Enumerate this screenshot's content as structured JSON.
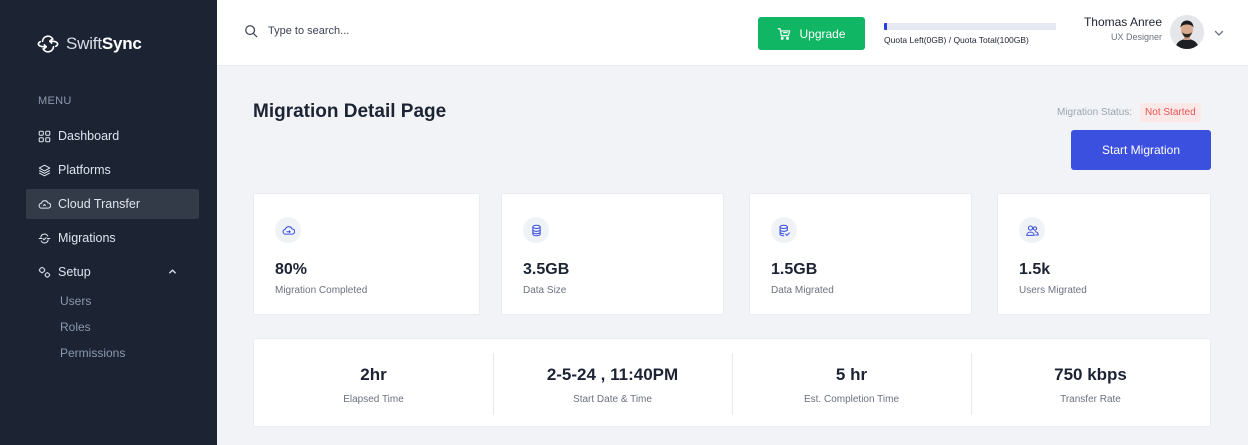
{
  "brand": {
    "name_light": "Swift",
    "name_bold": "Sync"
  },
  "sidebar": {
    "menu_label": "MENU",
    "items": [
      {
        "label": "Dashboard",
        "icon": "grid-icon"
      },
      {
        "label": "Platforms",
        "icon": "layers-icon"
      },
      {
        "label": "Cloud Transfer",
        "icon": "cloud-icon",
        "active": true
      },
      {
        "label": "Migrations",
        "icon": "migration-icon"
      },
      {
        "label": "Setup",
        "icon": "setup-icon",
        "expanded": true
      }
    ],
    "setup_subitems": [
      "Users",
      "Roles",
      "Permissions"
    ]
  },
  "header": {
    "search_placeholder": "Type to search...",
    "upgrade_label": "Upgrade",
    "quota_text": "Quota Left(0GB) / Quota Total(100GB)",
    "quota_fill_fraction": 0.02,
    "user_name": "Thomas Anree",
    "user_role": "UX Designer"
  },
  "main": {
    "title": "Migration Detail Page",
    "status_label": "Migration Status:",
    "status_value": "Not Started",
    "start_button": "Start Migration",
    "cards": [
      {
        "value": "80%",
        "label": "Migration Completed",
        "icon": "cloud-sync-icon"
      },
      {
        "value": "3.5GB",
        "label": "Data Size",
        "icon": "database-icon"
      },
      {
        "value": "1.5GB",
        "label": "Data Migrated",
        "icon": "database-check-icon"
      },
      {
        "value": "1.5k",
        "label": "Users Migrated",
        "icon": "users-icon"
      }
    ],
    "stats": [
      {
        "value": "2hr",
        "label": "Elapsed Time"
      },
      {
        "value": "2-5-24 , 11:40PM",
        "label": "Start Date & Time"
      },
      {
        "value": "5 hr",
        "label": "Est. Completion Time"
      },
      {
        "value": "750 kbps",
        "label": "Transfer Rate"
      }
    ]
  },
  "colors": {
    "sidebar_bg": "#1c2434",
    "accent": "#3c50e0",
    "upgrade_green": "#10b663",
    "status_red": "#e45454"
  }
}
